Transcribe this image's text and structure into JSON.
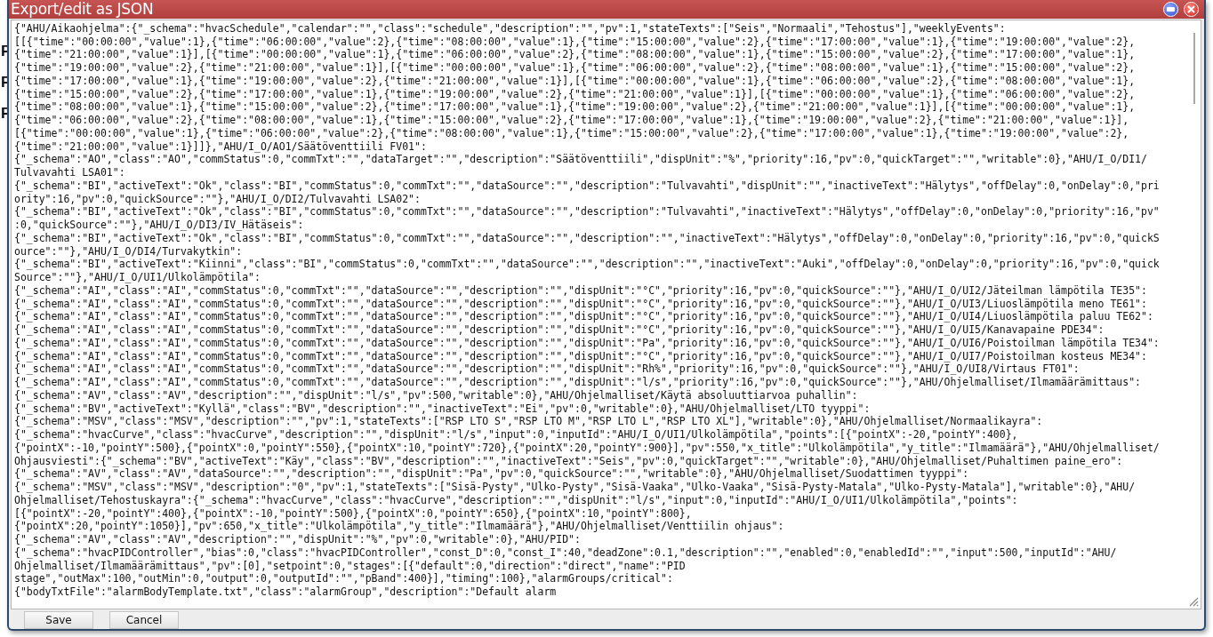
{
  "background": {
    "headings": [
      "F",
      "F",
      "F"
    ]
  },
  "dialog": {
    "title": "Export/edit as JSON",
    "editor": {
      "lines": [
        "{\"AHU/Aikaohjelma\":{\"_schema\":\"hvacSchedule\",\"calendar\":\"\",\"class\":\"schedule\",\"description\":\"\",\"pv\":1,\"stateTexts\":[\"Seis\",\"Normaali\",\"Tehostus\"],\"weeklyEvents\":",
        "[[{\"time\":\"00:00:00\",\"value\":1},{\"time\":\"06:00:00\",\"value\":2},{\"time\":\"08:00:00\",\"value\":1},{\"time\":\"15:00:00\",\"value\":2},{\"time\":\"17:00:00\",\"value\":1},{\"time\":\"19:00:00\",\"value\":2},",
        "{\"time\":\"21:00:00\",\"value\":1}],[{\"time\":\"00:00:00\",\"value\":1},{\"time\":\"06:00:00\",\"value\":2},{\"time\":\"08:00:00\",\"value\":1},{\"time\":\"15:00:00\",\"value\":2},{\"time\":\"17:00:00\",\"value\":1},",
        "{\"time\":\"19:00:00\",\"value\":2},{\"time\":\"21:00:00\",\"value\":1}],[{\"time\":\"00:00:00\",\"value\":1},{\"time\":\"06:00:00\",\"value\":2},{\"time\":\"08:00:00\",\"value\":1},{\"time\":\"15:00:00\",\"value\":2},",
        "{\"time\":\"17:00:00\",\"value\":1},{\"time\":\"19:00:00\",\"value\":2},{\"time\":\"21:00:00\",\"value\":1}],[{\"time\":\"00:00:00\",\"value\":1},{\"time\":\"06:00:00\",\"value\":2},{\"time\":\"08:00:00\",\"value\":1},",
        "{\"time\":\"15:00:00\",\"value\":2},{\"time\":\"17:00:00\",\"value\":1},{\"time\":\"19:00:00\",\"value\":2},{\"time\":\"21:00:00\",\"value\":1}],[{\"time\":\"00:00:00\",\"value\":1},{\"time\":\"06:00:00\",\"value\":2},",
        "{\"time\":\"08:00:00\",\"value\":1},{\"time\":\"15:00:00\",\"value\":2},{\"time\":\"17:00:00\",\"value\":1},{\"time\":\"19:00:00\",\"value\":2},{\"time\":\"21:00:00\",\"value\":1}],[{\"time\":\"00:00:00\",\"value\":1},",
        "{\"time\":\"06:00:00\",\"value\":2},{\"time\":\"08:00:00\",\"value\":1},{\"time\":\"15:00:00\",\"value\":2},{\"time\":\"17:00:00\",\"value\":1},{\"time\":\"19:00:00\",\"value\":2},{\"time\":\"21:00:00\",\"value\":1}],",
        "[{\"time\":\"00:00:00\",\"value\":1},{\"time\":\"06:00:00\",\"value\":2},{\"time\":\"08:00:00\",\"value\":1},{\"time\":\"15:00:00\",\"value\":2},{\"time\":\"17:00:00\",\"value\":1},{\"time\":\"19:00:00\",\"value\":2},",
        "{\"time\":\"21:00:00\",\"value\":1}]]},\"AHU/I_O/AO1/Säätöventtiili FV01\":",
        "{\"_schema\":\"AO\",\"class\":\"AO\",\"commStatus\":0,\"commTxt\":\"\",\"dataTarget\":\"\",\"description\":\"Säätöventtiili\",\"dispUnit\":\"%\",\"priority\":16,\"pv\":0,\"quickTarget\":\"\",\"writable\":0},\"AHU/I_O/DI1/",
        "Tulvavahti LSA01\":",
        "{\"_schema\":\"BI\",\"activeText\":\"Ok\",\"class\":\"BI\",\"commStatus\":0,\"commTxt\":\"\",\"dataSource\":\"\",\"description\":\"Tulvavahti\",\"dispUnit\":\"\",\"inactiveText\":\"Hälytys\",\"offDelay\":0,\"onDelay\":0,\"pri",
        "ority\":16,\"pv\":0,\"quickSource\":\"\"},\"AHU/I_O/DI2/Tulvavahti LSA02\":",
        "{\"_schema\":\"BI\",\"activeText\":\"Ok\",\"class\":\"BI\",\"commStatus\":0,\"commTxt\":\"\",\"dataSource\":\"\",\"description\":\"Tulvavahti\",\"inactiveText\":\"Hälytys\",\"offDelay\":0,\"onDelay\":0,\"priority\":16,\"pv\"",
        ":0,\"quickSource\":\"\"},\"AHU/I_O/DI3/IV_Hätäseis\":",
        "{\"_schema\":\"BI\",\"activeText\":\"Ok\",\"class\":\"BI\",\"commStatus\":0,\"commTxt\":\"\",\"dataSource\":\"\",\"description\":\"\",\"inactiveText\":\"Hälytys\",\"offDelay\":0,\"onDelay\":0,\"priority\":16,\"pv\":0,\"quickS",
        "ource\":\"\"},\"AHU/I_O/DI4/Turvakytkin\":",
        "{\"_schema\":\"BI\",\"activeText\":\"Kiinni\",\"class\":\"BI\",\"commStatus\":0,\"commTxt\":\"\",\"dataSource\":\"\",\"description\":\"\",\"inactiveText\":\"Auki\",\"offDelay\":0,\"onDelay\":0,\"priority\":16,\"pv\":0,\"quick",
        "Source\":\"\"},\"AHU/I_O/UI1/Ulkolämpötila\":",
        "{\"_schema\":\"AI\",\"class\":\"AI\",\"commStatus\":0,\"commTxt\":\"\",\"dataSource\":\"\",\"description\":\"\",\"dispUnit\":\"°C\",\"priority\":16,\"pv\":0,\"quickSource\":\"\"},\"AHU/I_O/UI2/Jäteilman lämpötila TE35\":",
        "{\"_schema\":\"AI\",\"class\":\"AI\",\"commStatus\":0,\"commTxt\":\"\",\"dataSource\":\"\",\"description\":\"\",\"dispUnit\":\"°C\",\"priority\":16,\"pv\":0,\"quickSource\":\"\"},\"AHU/I_O/UI3/Liuoslämpötila meno TE61\":",
        "{\"_schema\":\"AI\",\"class\":\"AI\",\"commStatus\":0,\"commTxt\":\"\",\"dataSource\":\"\",\"description\":\"\",\"dispUnit\":\"°C\",\"priority\":16,\"pv\":0,\"quickSource\":\"\"},\"AHU/I_O/UI4/Liuoslämpötila paluu TE62\":",
        "{\"_schema\":\"AI\",\"class\":\"AI\",\"commStatus\":0,\"commTxt\":\"\",\"dataSource\":\"\",\"description\":\"\",\"dispUnit\":\"°C\",\"priority\":16,\"pv\":0,\"quickSource\":\"\"},\"AHU/I_O/UI5/Kanavapaine PDE34\":",
        "{\"_schema\":\"AI\",\"class\":\"AI\",\"commStatus\":0,\"commTxt\":\"\",\"dataSource\":\"\",\"description\":\"\",\"dispUnit\":\"Pa\",\"priority\":16,\"pv\":0,\"quickSource\":\"\"},\"AHU/I_O/UI6/Poistoilman lämpötila TE34\":",
        "{\"_schema\":\"AI\",\"class\":\"AI\",\"commStatus\":0,\"commTxt\":\"\",\"dataSource\":\"\",\"description\":\"\",\"dispUnit\":\"°C\",\"priority\":16,\"pv\":0,\"quickSource\":\"\"},\"AHU/I_O/UI7/Poistoilman kosteus ME34\":",
        "{\"_schema\":\"AI\",\"class\":\"AI\",\"commStatus\":0,\"commTxt\":\"\",\"dataSource\":\"\",\"description\":\"\",\"dispUnit\":\"Rh%\",\"priority\":16,\"pv\":0,\"quickSource\":\"\"},\"AHU/I_O/UI8/Virtaus FT01\":",
        "{\"_schema\":\"AI\",\"class\":\"AI\",\"commStatus\":0,\"commTxt\":\"\",\"dataSource\":\"\",\"description\":\"\",\"dispUnit\":\"l/s\",\"priority\":16,\"pv\":0,\"quickSource\":\"\"},\"AHU/Ohjelmalliset/Ilmamäärämittaus\":",
        "{\"_schema\":\"AV\",\"class\":\"AV\",\"description\":\"\",\"dispUnit\":\"l/s\",\"pv\":500,\"writable\":0},\"AHU/Ohjelmalliset/Käytä absoluuttiarvoa puhallin\":",
        "{\"_schema\":\"BV\",\"activeText\":\"Kyllä\",\"class\":\"BV\",\"description\":\"\",\"inactiveText\":\"Ei\",\"pv\":0,\"writable\":0},\"AHU/Ohjelmalliset/LTO tyyppi\":",
        "{\"_schema\":\"MSV\",\"class\":\"MSV\",\"description\":\"\",\"pv\":1,\"stateTexts\":[\"RSP LTO S\",\"RSP LTO M\",\"RSP LTO L\",\"RSP LTO XL\"],\"writable\":0},\"AHU/Ohjelmalliset/Normaalikayra\":",
        "{\"_schema\":\"hvacCurve\",\"class\":\"hvacCurve\",\"description\":\"\",\"dispUnit\":\"l/s\",\"input\":0,\"inputId\":\"AHU/I_O/UI1/Ulkolämpötila\",\"points\":[{\"pointX\":-20,\"pointY\":400},",
        "{\"pointX\":-10,\"pointY\":500},{\"pointX\":0,\"pointY\":550},{\"pointX\":10,\"pointY\":720},{\"pointX\":20,\"pointY\":900}],\"pv\":550,\"x_title\":\"Ulkolämpötila\",\"y_title\":\"Ilmamäärä\"},\"AHU/Ohjelmalliset/",
        "Ohjausviesti\":{\"_schema\":\"BV\",\"activeText\":\"Käy\",\"class\":\"BV\",\"description\":\"\",\"inactiveText\":\"Seis\",\"pv\":0,\"quickTarget\":\"\",\"writable\":0},\"AHU/Ohjelmalliset/Puhaltimen paine_ero\":",
        "{\"_schema\":\"AV\",\"class\":\"AV\",\"dataSource\":\"\",\"description\":\"\",\"dispUnit\":\"Pa\",\"pv\":0,\"quickSource\":\"\",\"writable\":0},\"AHU/Ohjelmalliset/Suodattimen tyyppi\":",
        "{\"_schema\":\"MSV\",\"class\":\"MSV\",\"description\":\"0\",\"pv\":1,\"stateTexts\":[\"Sisä-Pysty\",\"Ulko-Pysty\",\"Sisä-Vaaka\",\"Ulko-Vaaka\",\"Sisä-Pysty-Matala\",\"Ulko-Pysty-Matala\"],\"writable\":0},\"AHU/",
        "Ohjelmalliset/Tehostuskayra\":{\"_schema\":\"hvacCurve\",\"class\":\"hvacCurve\",\"description\":\"\",\"dispUnit\":\"l/s\",\"input\":0,\"inputId\":\"AHU/I_O/UI1/Ulkolämpötila\",\"points\":",
        "[{\"pointX\":-20,\"pointY\":400},{\"pointX\":-10,\"pointY\":500},{\"pointX\":0,\"pointY\":650},{\"pointX\":10,\"pointY\":800},",
        "{\"pointX\":20,\"pointY\":1050}],\"pv\":650,\"x_title\":\"Ulkolämpötila\",\"y_title\":\"Ilmamäärä\"},\"AHU/Ohjelmalliset/Venttiilin ohjaus\":",
        "{\"_schema\":\"AV\",\"class\":\"AV\",\"description\":\"\",\"dispUnit\":\"%\",\"pv\":0,\"writable\":0},\"AHU/PID\":",
        "{\"_schema\":\"hvacPIDController\",\"bias\":0,\"class\":\"hvacPIDController\",\"const_D\":0,\"const_I\":40,\"deadZone\":0.1,\"description\":\"\",\"enabled\":0,\"enabledId\":\"\",\"input\":500,\"inputId\":\"AHU/",
        "Ohjelmalliset/Ilmamäärämittaus\",\"pv\":[0],\"setpoint\":0,\"stages\":[{\"default\":0,\"direction\":\"direct\",\"name\":\"PID",
        "stage\",\"outMax\":100,\"outMin\":0,\"output\":0,\"outputId\":\"\",\"pBand\":400}],\"timing\":100},\"alarmGroups/critical\":",
        "{\"bodyTxtFile\":\"alarmBodyTemplate.txt\",\"class\":\"alarmGroup\",\"description\":\"Default alarm"
      ]
    },
    "buttons": [
      "Save",
      "Cancel"
    ]
  }
}
